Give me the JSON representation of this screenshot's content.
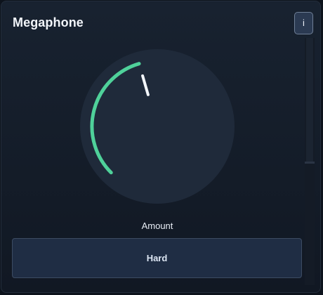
{
  "window": {
    "title": "Megaphone"
  },
  "info_button": {
    "label": "i"
  },
  "knob": {
    "label": "Amount",
    "value_fraction": 0.44,
    "track_color": "#1f2a3a",
    "accent_color": "#4fd19a",
    "indicator_color": "#f3f6fb"
  },
  "mode_button": {
    "label": "Hard"
  }
}
